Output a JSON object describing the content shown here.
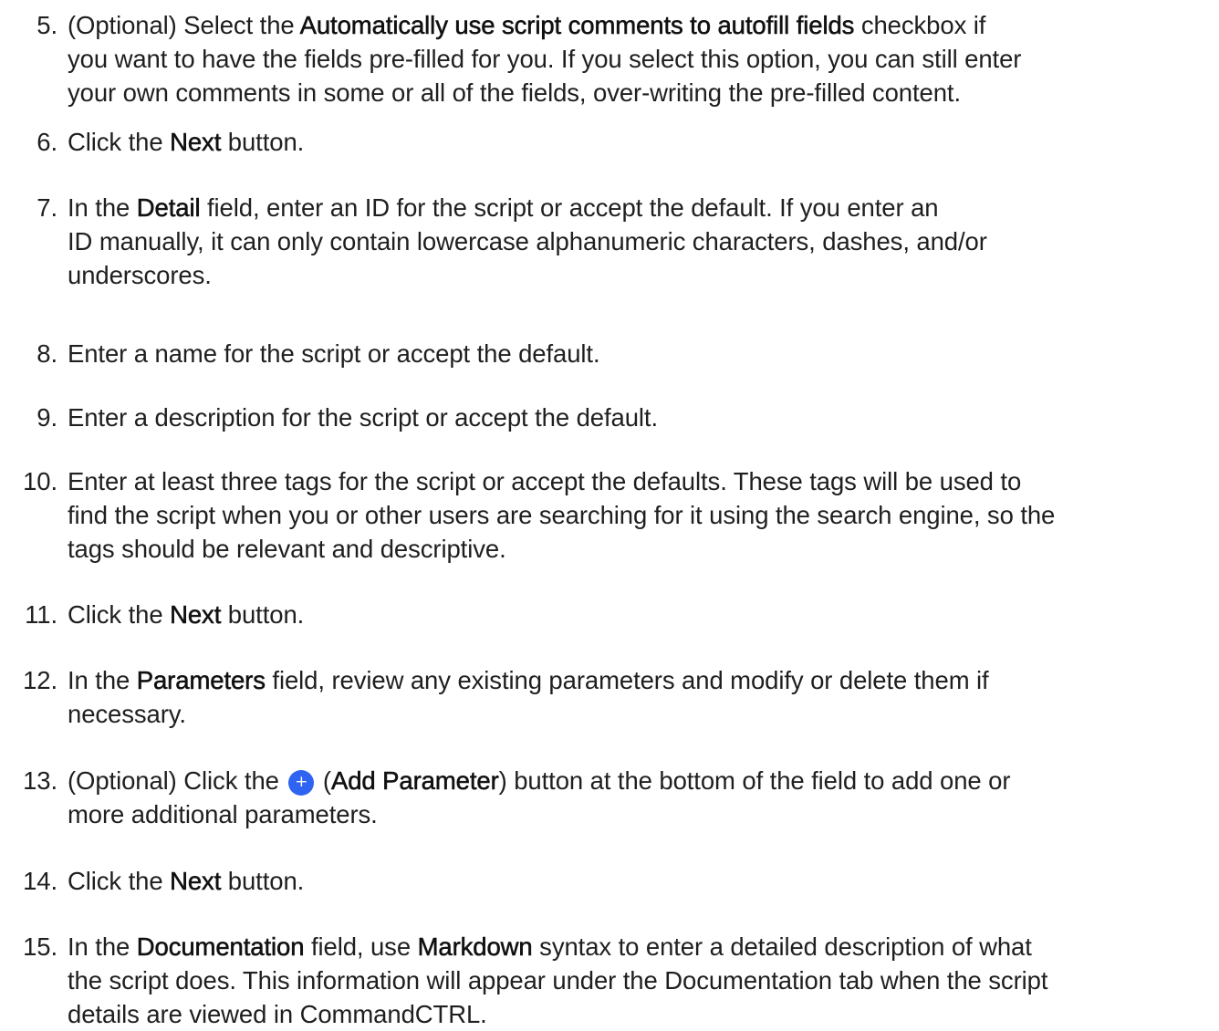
{
  "steps": [
    {
      "number": "5.",
      "lines": [
        [
          "(Optional) Select the ",
          {
            "b": "Automatically use script comments to autofill fields"
          },
          " checkbox if"
        ],
        [
          "you want to have the fields pre-filled for you. If you select this option, you can still enter"
        ],
        [
          "your own comments in some or all of the fields, over-writing the pre-filled content."
        ]
      ]
    },
    {
      "number": "6.",
      "lines": [
        [
          "Click the ",
          {
            "b": "Next"
          },
          " button."
        ]
      ]
    },
    {
      "number": "7.",
      "lines": [
        [
          "In the ",
          {
            "b": "Detail"
          },
          " field, enter an ID for the script or accept the default. If you enter an"
        ],
        [
          "ID manually, it can only contain lowercase alphanumeric characters, dashes, and/or"
        ],
        [
          "underscores."
        ]
      ]
    },
    {
      "number": "8.",
      "lines": [
        [
          "Enter a name for the script or accept the default."
        ]
      ]
    },
    {
      "number": "9.",
      "lines": [
        [
          "Enter a description for the script or accept the default."
        ]
      ]
    },
    {
      "number": "10.",
      "lines": [
        [
          "Enter at least three tags for the script or accept the defaults. These tags will be used to"
        ],
        [
          "find the script when you or other users are searching for it using the search engine, so the"
        ],
        [
          "tags should be relevant and descriptive."
        ]
      ]
    },
    {
      "number": "11.",
      "lines": [
        [
          "Click the ",
          {
            "b": "Next"
          },
          " button."
        ]
      ]
    },
    {
      "number": "12.",
      "lines": [
        [
          "In the ",
          {
            "b": "Parameters"
          },
          " field, review any existing parameters and modify or delete them if"
        ],
        [
          "necessary."
        ]
      ]
    },
    {
      "number": "13.",
      "lines": [
        [
          "(Optional) Click the ",
          {
            "icon": "add-parameter-icon",
            "glyph": "+"
          },
          " (",
          {
            "b": "Add Parameter"
          },
          ") button at the bottom of the field to add one or"
        ],
        [
          "more additional parameters."
        ]
      ]
    },
    {
      "number": "14.",
      "lines": [
        [
          "Click the ",
          {
            "b": "Next"
          },
          " button."
        ]
      ]
    },
    {
      "number": "15.",
      "lines": [
        [
          "In the ",
          {
            "b": "Documentation"
          },
          " field, use ",
          {
            "b": "Markdown"
          },
          " syntax to enter a detailed description of what"
        ],
        [
          "the script does. This information will appear under the Documentation tab when the script"
        ],
        [
          "details are viewed in CommandCTRL."
        ]
      ]
    }
  ],
  "colors": {
    "text": "#1f1f1f",
    "add_icon": "#2f64f2"
  }
}
